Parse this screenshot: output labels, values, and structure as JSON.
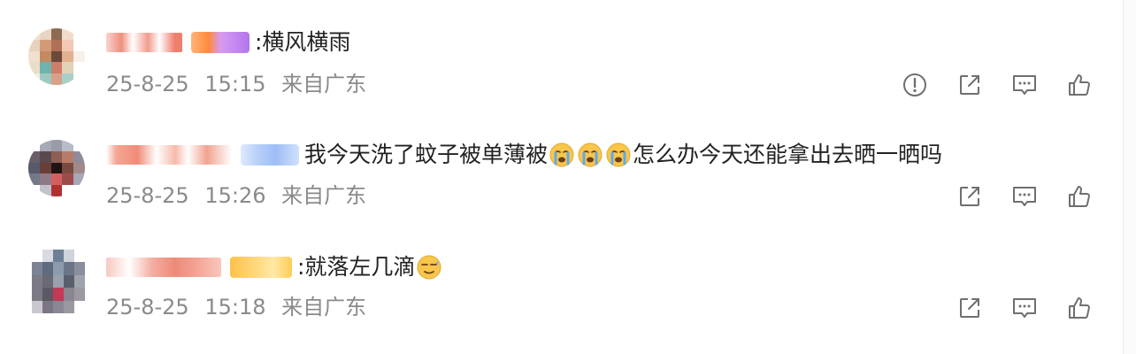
{
  "comments": [
    {
      "text": ":横风横雨",
      "date": "25-8-25",
      "time": "15:15",
      "location": "来自广东",
      "actions": [
        "report-icon",
        "share-icon",
        "reply-icon",
        "like-icon"
      ]
    },
    {
      "text_before": "我今天洗了蚊子被单薄被",
      "text_after": "怎么办今天还能拿出去晒一晒吗",
      "date": "25-8-25",
      "time": "15:26",
      "location": "来自广东",
      "actions": [
        "share-icon",
        "reply-icon",
        "like-icon"
      ]
    },
    {
      "text": ":就落左几滴",
      "date": "25-8-25",
      "time": "15:18",
      "location": "来自广东",
      "actions": [
        "share-icon",
        "reply-icon",
        "like-icon"
      ]
    }
  ],
  "colors": {
    "text": "#222222",
    "meta": "#8a8a8a",
    "icon": "#6f6f6f",
    "emoji_face": "#f7c64b",
    "emoji_tears": "#5fa9ee"
  }
}
